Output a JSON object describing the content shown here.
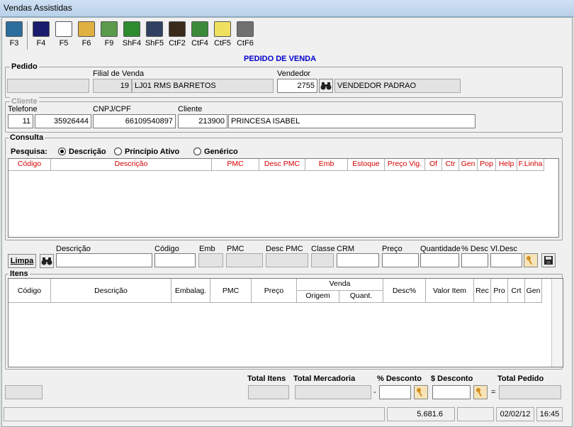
{
  "window": {
    "title": "Vendas Assistidas"
  },
  "toolbar": [
    {
      "key": "F3",
      "icon": "exit-door-icon",
      "color": "#2c6e9e"
    },
    {
      "key": "F4",
      "icon": "save-disk-icon",
      "color": "#1a1a6e"
    },
    {
      "key": "F5",
      "icon": "document-list-icon",
      "color": "#ffffff"
    },
    {
      "key": "F6",
      "icon": "boxes-icon",
      "color": "#e0b040"
    },
    {
      "key": "F9",
      "icon": "recycle-icon",
      "color": "#5a9a4a"
    },
    {
      "key": "ShF4",
      "icon": "money-icon",
      "color": "#2d8a2d"
    },
    {
      "key": "ShF5",
      "icon": "people-icon",
      "color": "#304060"
    },
    {
      "key": "CtF2",
      "icon": "book-icon",
      "color": "#3a2a1a"
    },
    {
      "key": "CtF4",
      "icon": "chart-icon",
      "color": "#3a8a3a"
    },
    {
      "key": "CtF5",
      "icon": "lightbulb-icon",
      "color": "#f0e060"
    },
    {
      "key": "CtF6",
      "icon": "trash-icon",
      "color": "#707070"
    }
  ],
  "form_title": "PEDIDO DE VENDA",
  "pedido": {
    "legend": "Pedido",
    "filial_label": "Filial de Venda",
    "filial_code": "19",
    "filial_name": "LJ01 RMS BARRETOS",
    "vendedor_label": "Vendedor",
    "vendedor_code": "2755",
    "vendedor_name": "VENDEDOR PADRAO"
  },
  "cliente": {
    "legend": "Cliente",
    "telefone_label": "Telefone",
    "ddd": "11",
    "telefone": "35926444",
    "cnpj_label": "CNPJ/CPF",
    "cnpj": "66109540897",
    "cliente_label": "Cliente",
    "cliente_code": "213900",
    "cliente_name": "PRINCESA ISABEL"
  },
  "consulta": {
    "legend": "Consulta",
    "pesquisa_label": "Pesquisa:",
    "options": [
      "Descrição",
      "Princípio Ativo",
      "Genérico"
    ],
    "selected": "Descrição",
    "columns": [
      "Código",
      "Descrição",
      "PMC",
      "Desc PMC",
      "Emb",
      "Estoque",
      "Preço Vig.",
      "Of",
      "Ctr",
      "Gen",
      "Pop",
      "Help",
      "F.Linha"
    ]
  },
  "entry": {
    "limpa_label": "Limpa",
    "descricao_label": "Descrição",
    "codigo_label": "Código",
    "emb_label": "Emb",
    "pmc_label": "PMC",
    "desc_pmc_label": "Desc PMC",
    "classe_label": "Classe",
    "crm_label": "CRM",
    "preco_label": "Preço",
    "quantidade_label": "Quantidade",
    "pct_desc_label": "% Desc",
    "vl_desc_label": "Vl.Desc"
  },
  "itens": {
    "legend": "Itens",
    "columns": [
      "Código",
      "Descrição",
      "Embalag.",
      "PMC",
      "Preço",
      "Venda",
      "Desc%",
      "Valor Item",
      "Rec",
      "Pro",
      "Crt",
      "Gen"
    ],
    "venda_sub": [
      "Origem",
      "Quant."
    ]
  },
  "totals": {
    "total_itens_label": "Total Itens",
    "total_mercadoria_label": "Total Mercadoria",
    "pct_desconto_label": "% Desconto",
    "valor_desconto_label": "$ Desconto",
    "total_pedido_label": "Total Pedido",
    "minus": "-",
    "equals": "="
  },
  "status": {
    "value": "5.681.6",
    "date": "02/02/12",
    "time": "16:45"
  }
}
